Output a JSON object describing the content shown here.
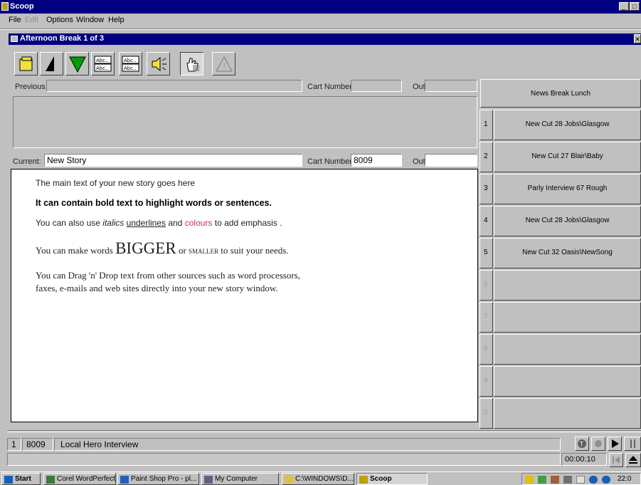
{
  "app": {
    "title": "Scoop"
  },
  "menu": [
    "File",
    "Edit",
    "Options",
    "Window",
    "Help"
  ],
  "document": {
    "title": "Afternoon Break 1 of 3"
  },
  "previous": {
    "label": "Previous:",
    "value": "",
    "cart_label": "Cart Number",
    "cart_value": "",
    "out_label": "Out",
    "out_value": ""
  },
  "current": {
    "label": "Current:",
    "value": "New Story",
    "cart_label": "Cart Number",
    "cart_value": "8009",
    "out_label": "Out",
    "out_value": ""
  },
  "story": {
    "line1": "The main text of your new story goes here",
    "line2": "It can contain bold text to highlight words or sentences.",
    "line3_a": "You can also use ",
    "line3_italic": "italics",
    "line3_b": " ",
    "line3_underline": "underlines",
    "line3_c": " and ",
    "line3_colour": "colours",
    "line3_d": " to add emphasis .",
    "line4_a": "You can make words ",
    "line4_big": "BIGGER",
    "line4_b": " or ",
    "line4_small": "SMALLER",
    "line4_c": " to suit your needs.",
    "line5": "You can Drag 'n' Drop text from other sources such as word processors,",
    "line6": "faxes, e-mails and web sites directly into your new story window."
  },
  "carts": {
    "header": "News Break Lunch",
    "slots": [
      {
        "num": "1",
        "label": "New Cut 28 Jobs\\Glasgow"
      },
      {
        "num": "2",
        "label": "New Cut 27 Blair\\Baby"
      },
      {
        "num": "3",
        "label": "Parly Interview 67 Rough"
      },
      {
        "num": "4",
        "label": "New Cut 28 Jobs\\Glasgow"
      },
      {
        "num": "5",
        "label": "New Cut 32 Oasis\\NewSong"
      },
      {
        "num": "6",
        "label": ""
      },
      {
        "num": "7",
        "label": ""
      },
      {
        "num": "8",
        "label": ""
      },
      {
        "num": "9",
        "label": ""
      },
      {
        "num": "0",
        "label": ""
      }
    ]
  },
  "player": {
    "slot": "1",
    "cart": "8009",
    "title": "Local Hero Interview",
    "time": "00:00:10"
  },
  "taskbar": {
    "start": "Start",
    "items": [
      "Corel WordPerfect ...",
      "Paint Shop Pro - pl...",
      "My Computer",
      "C:\\WINDOWS\\D...",
      "Scoop"
    ],
    "clock": "22:0"
  },
  "colors": {
    "titlebar": "#000080",
    "face": "#c0c0c0",
    "emphasis": "#c0307a"
  },
  "icons": [
    "folder-icon",
    "cue-marker-icon",
    "cue-down-icon",
    "text-styles-icon",
    "text-styles-alt-icon",
    "speaker-icon",
    "hand-drag-icon",
    "warning-icon"
  ]
}
